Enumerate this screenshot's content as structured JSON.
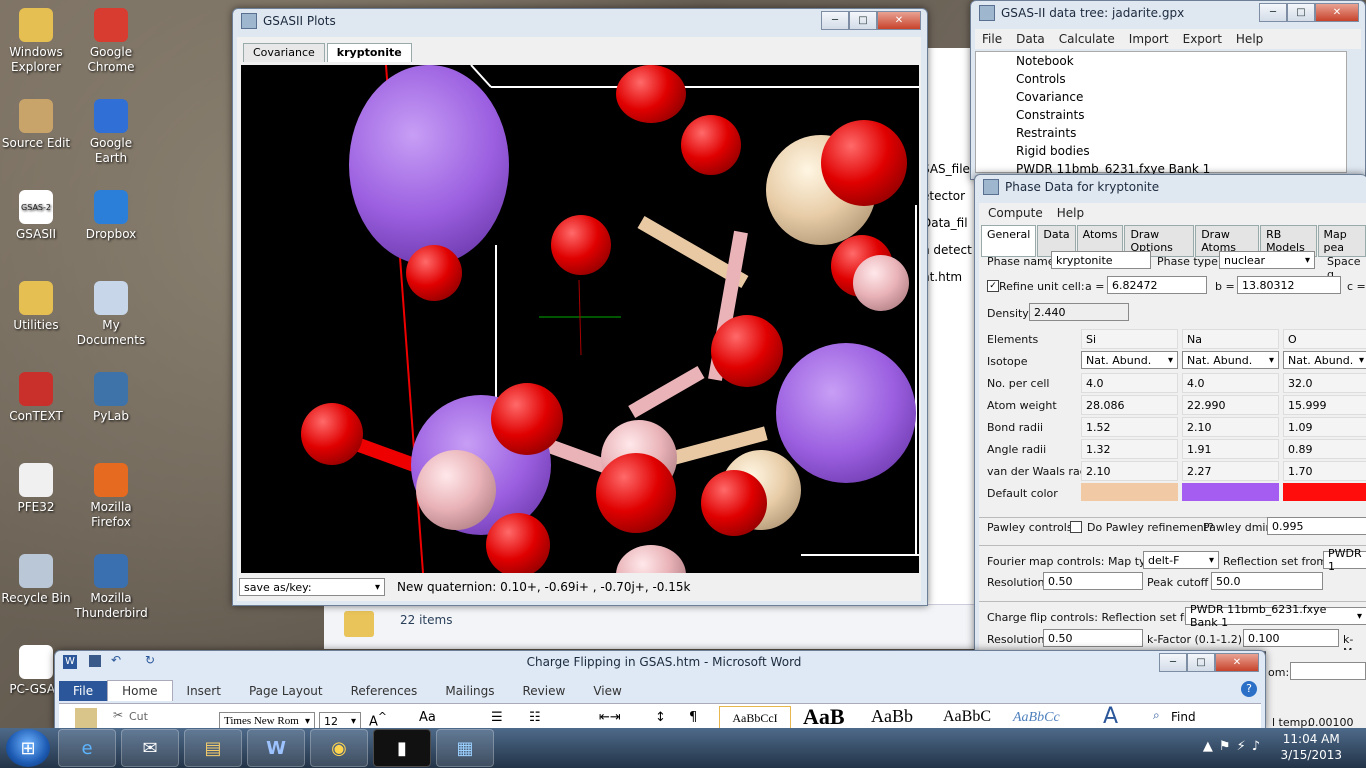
{
  "desktop": {
    "icons": [
      {
        "label": "Windows\nExplorer",
        "icon": "folder-explorer-icon"
      },
      {
        "label": "Google\nChrome",
        "icon": "chrome-icon"
      },
      {
        "label": "Source Edit",
        "icon": "source-edit-icon"
      },
      {
        "label": "Google Earth",
        "icon": "google-earth-icon"
      },
      {
        "label": "GSASII",
        "icon": "gsas-icon",
        "badge": "GSAS-2"
      },
      {
        "label": "Dropbox",
        "icon": "dropbox-icon"
      },
      {
        "label": "Utilities",
        "icon": "folder-icon"
      },
      {
        "label": "My\nDocuments",
        "icon": "documents-icon"
      },
      {
        "label": "ConTEXT",
        "icon": "context-icon"
      },
      {
        "label": "PyLab",
        "icon": "python-icon"
      },
      {
        "label": "PFE32",
        "icon": "pfe-icon"
      },
      {
        "label": "Mozilla\nFirefox",
        "icon": "firefox-icon"
      },
      {
        "label": "Recycle Bin",
        "icon": "recycle-bin-icon"
      },
      {
        "label": "Mozilla\nThunderbird",
        "icon": "thunderbird-icon"
      },
      {
        "label": "PC-GSAS",
        "icon": "pc-gsas-icon"
      }
    ]
  },
  "plot_window": {
    "title": "GSASII Plots",
    "tabs": [
      "Covariance",
      "kryptonite"
    ],
    "active_tab": "kryptonite",
    "save_combo": "save as/key:",
    "status": "New quaternion: 0.10+, -0.69i+ , -0.70j+, -0.15k"
  },
  "explorer_fragments": {
    "items": [
      "SAS_file",
      "etector",
      "Data_fil",
      "n detect",
      "nt.htm"
    ],
    "count": "22 items"
  },
  "data_tree": {
    "title": "GSAS-II data tree: jadarite.gpx",
    "menu": [
      "File",
      "Data",
      "Calculate",
      "Import",
      "Export",
      "Help"
    ],
    "items": [
      "Notebook",
      "Controls",
      "Covariance",
      "Constraints",
      "Restraints",
      "Rigid bodies",
      "PWDR 11bmb_6231.fxye Bank 1"
    ]
  },
  "phase_data": {
    "title": "Phase Data for kryptonite",
    "menu": [
      "Compute",
      "Help"
    ],
    "tabs": [
      "General",
      "Data",
      "Atoms",
      "Draw Options",
      "Draw Atoms",
      "RB Models",
      "Map pea"
    ],
    "phase_name_label": "Phase name:",
    "phase_name": "kryptonite",
    "phase_type_label": "Phase type:",
    "phase_type": "nuclear",
    "space_group_label": "Space g",
    "refine_label": "Refine unit cell:",
    "a_label": "a =",
    "a_value": "6.82472",
    "b_label": "b =",
    "b_value": "13.80312",
    "c_label": "c =",
    "density_label": "Density:",
    "density": "2.440",
    "table": {
      "row_labels": [
        "Elements",
        "Isotope",
        "No. per cell",
        "Atom weight",
        "Bond radii",
        "Angle radii",
        "van der Waals radii",
        "Default color"
      ],
      "columns": [
        {
          "values": [
            "Si",
            "Nat. Abund.",
            "4.0",
            "28.086",
            "1.52",
            "1.32",
            "2.10"
          ],
          "color": "#f1c9a5"
        },
        {
          "values": [
            "Na",
            "Nat. Abund.",
            "4.0",
            "22.990",
            "2.10",
            "1.91",
            "2.27"
          ],
          "color": "#a55cf0"
        },
        {
          "values": [
            "O",
            "Nat. Abund.",
            "32.0",
            "15.999",
            "1.09",
            "0.89",
            "1.70"
          ],
          "color": "#ff0d0d"
        }
      ]
    },
    "pawley_label": "Pawley controls:",
    "pawley_check": "Do Pawley refinement?",
    "pawley_dmin_label": "Pawley dmin:",
    "pawley_dmin": "0.995",
    "fourier_label": "Fourier map controls: Map type:",
    "map_type": "delt-F",
    "refl_set_label": "Reflection set from:",
    "refl_set": "PWDR 1",
    "resolution_label": "Resolution:",
    "resolution": "0.50",
    "peak_cutoff_label": "Peak cutoff %:",
    "peak_cutoff": "50.0",
    "cf_label": "Charge flip controls: Reflection set from:",
    "cf_refl": "PWDR 11bmb_6231.fxye Bank 1",
    "cf_resolution": "0.50",
    "kfactor_label": "k-Factor (0.1-1.2):",
    "kfactor": "0.100",
    "kmax_label": "k-Ma",
    "hidden_label": "om:",
    "temp_label": "l temp:",
    "temp_value": "0.00100"
  },
  "word_window": {
    "title": "Charge Flipping in GSAS.htm  -  Microsoft Word",
    "tabs": [
      "File",
      "Home",
      "Insert",
      "Page Layout",
      "References",
      "Mailings",
      "Review",
      "View"
    ],
    "font": "Times New Rom",
    "size": "12",
    "cut": "Cut",
    "find": "Find",
    "styles": [
      "AaBbCcI",
      "AaB",
      "AaBb",
      "AaBbC",
      "AaBbCc"
    ]
  },
  "taskbar": {
    "time": "11:04 AM",
    "date": "3/15/2013"
  }
}
